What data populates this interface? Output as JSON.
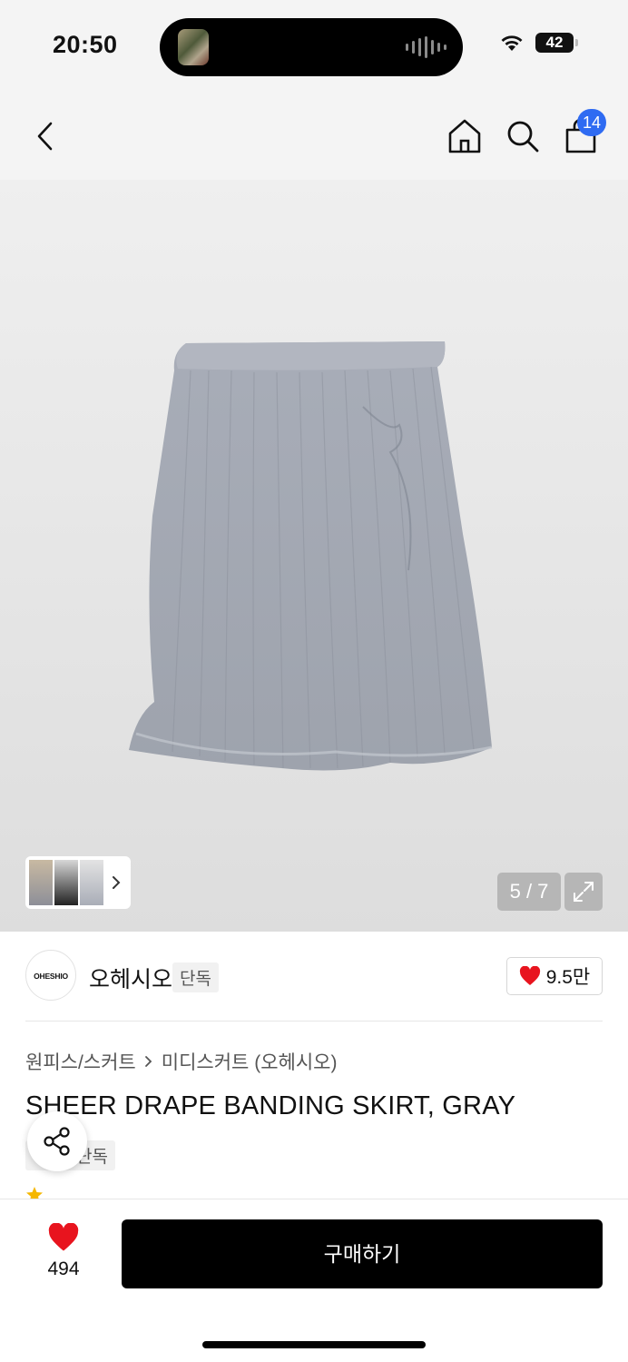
{
  "status_bar": {
    "time": "20:50",
    "battery": "42"
  },
  "nav": {
    "cart_count": "14"
  },
  "gallery": {
    "counter": "5 / 7"
  },
  "brand": {
    "logo_text": "OHESHIO",
    "name": "오헤시오",
    "tag": "단독",
    "likes": "9.5만"
  },
  "breadcrumb": {
    "category": "원피스/스커트",
    "subcategory": "미디스커트 (오헤시오)"
  },
  "product": {
    "title": "SHEER DRAPE BANDING SKIRT, GRAY",
    "tag": "단독"
  },
  "bottom_bar": {
    "wish_count": "494",
    "buy_label": "구매하기"
  },
  "colors": {
    "accent_blue": "#2f6bf2",
    "heart_red": "#e8141e"
  }
}
